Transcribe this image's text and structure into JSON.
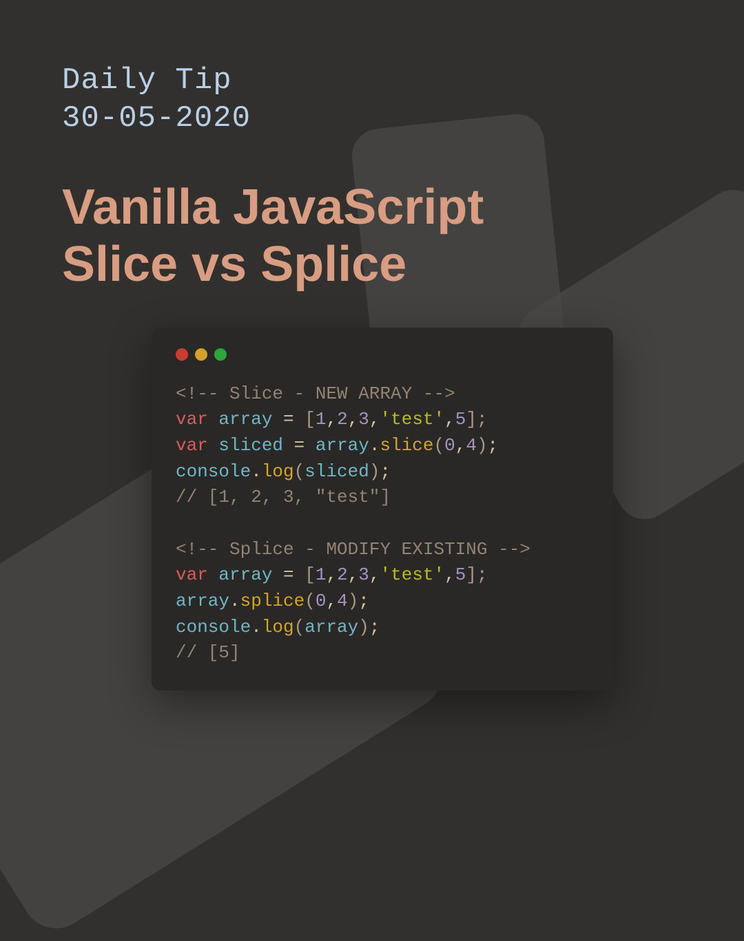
{
  "header": {
    "label_line1": "Daily Tip",
    "label_line2": "30-05-2020",
    "title_line1": "Vanilla JavaScript",
    "title_line2": "Slice vs Splice"
  },
  "code": {
    "slice": {
      "comment_open": "<!-- ",
      "comment_text": "Slice - NEW ARRAY",
      "comment_close": " -->",
      "var_kw": "var",
      "arr_name": "array",
      "equals": " = ",
      "arr_open": "[",
      "n1": "1",
      "n2": "2",
      "n3": "3",
      "str_test": "'test'",
      "n5": "5",
      "arr_close": "];",
      "sliced_name": "sliced",
      "slice_call_obj": "array",
      "slice_fn": "slice",
      "slice_arg1": "0",
      "slice_arg2": "4",
      "console": "console",
      "log": "log",
      "log_arg": "sliced",
      "result": "// [1, 2, 3, \"test\"]"
    },
    "splice": {
      "comment_open": "<!-- ",
      "comment_text": "Splice - MODIFY EXISTING",
      "comment_close": " -->",
      "var_kw": "var",
      "arr_name": "array",
      "equals": " = ",
      "arr_open": "[",
      "n1": "1",
      "n2": "2",
      "n3": "3",
      "str_test": "'test'",
      "n5": "5",
      "arr_close": "];",
      "splice_obj": "array",
      "splice_fn": "splice",
      "splice_arg1": "0",
      "splice_arg2": "4",
      "console": "console",
      "log": "log",
      "log_arg": "array",
      "result": "// [5]"
    },
    "comma": ",",
    "paren_open": "(",
    "paren_close": ")",
    "semi": ";",
    "dot": "."
  }
}
